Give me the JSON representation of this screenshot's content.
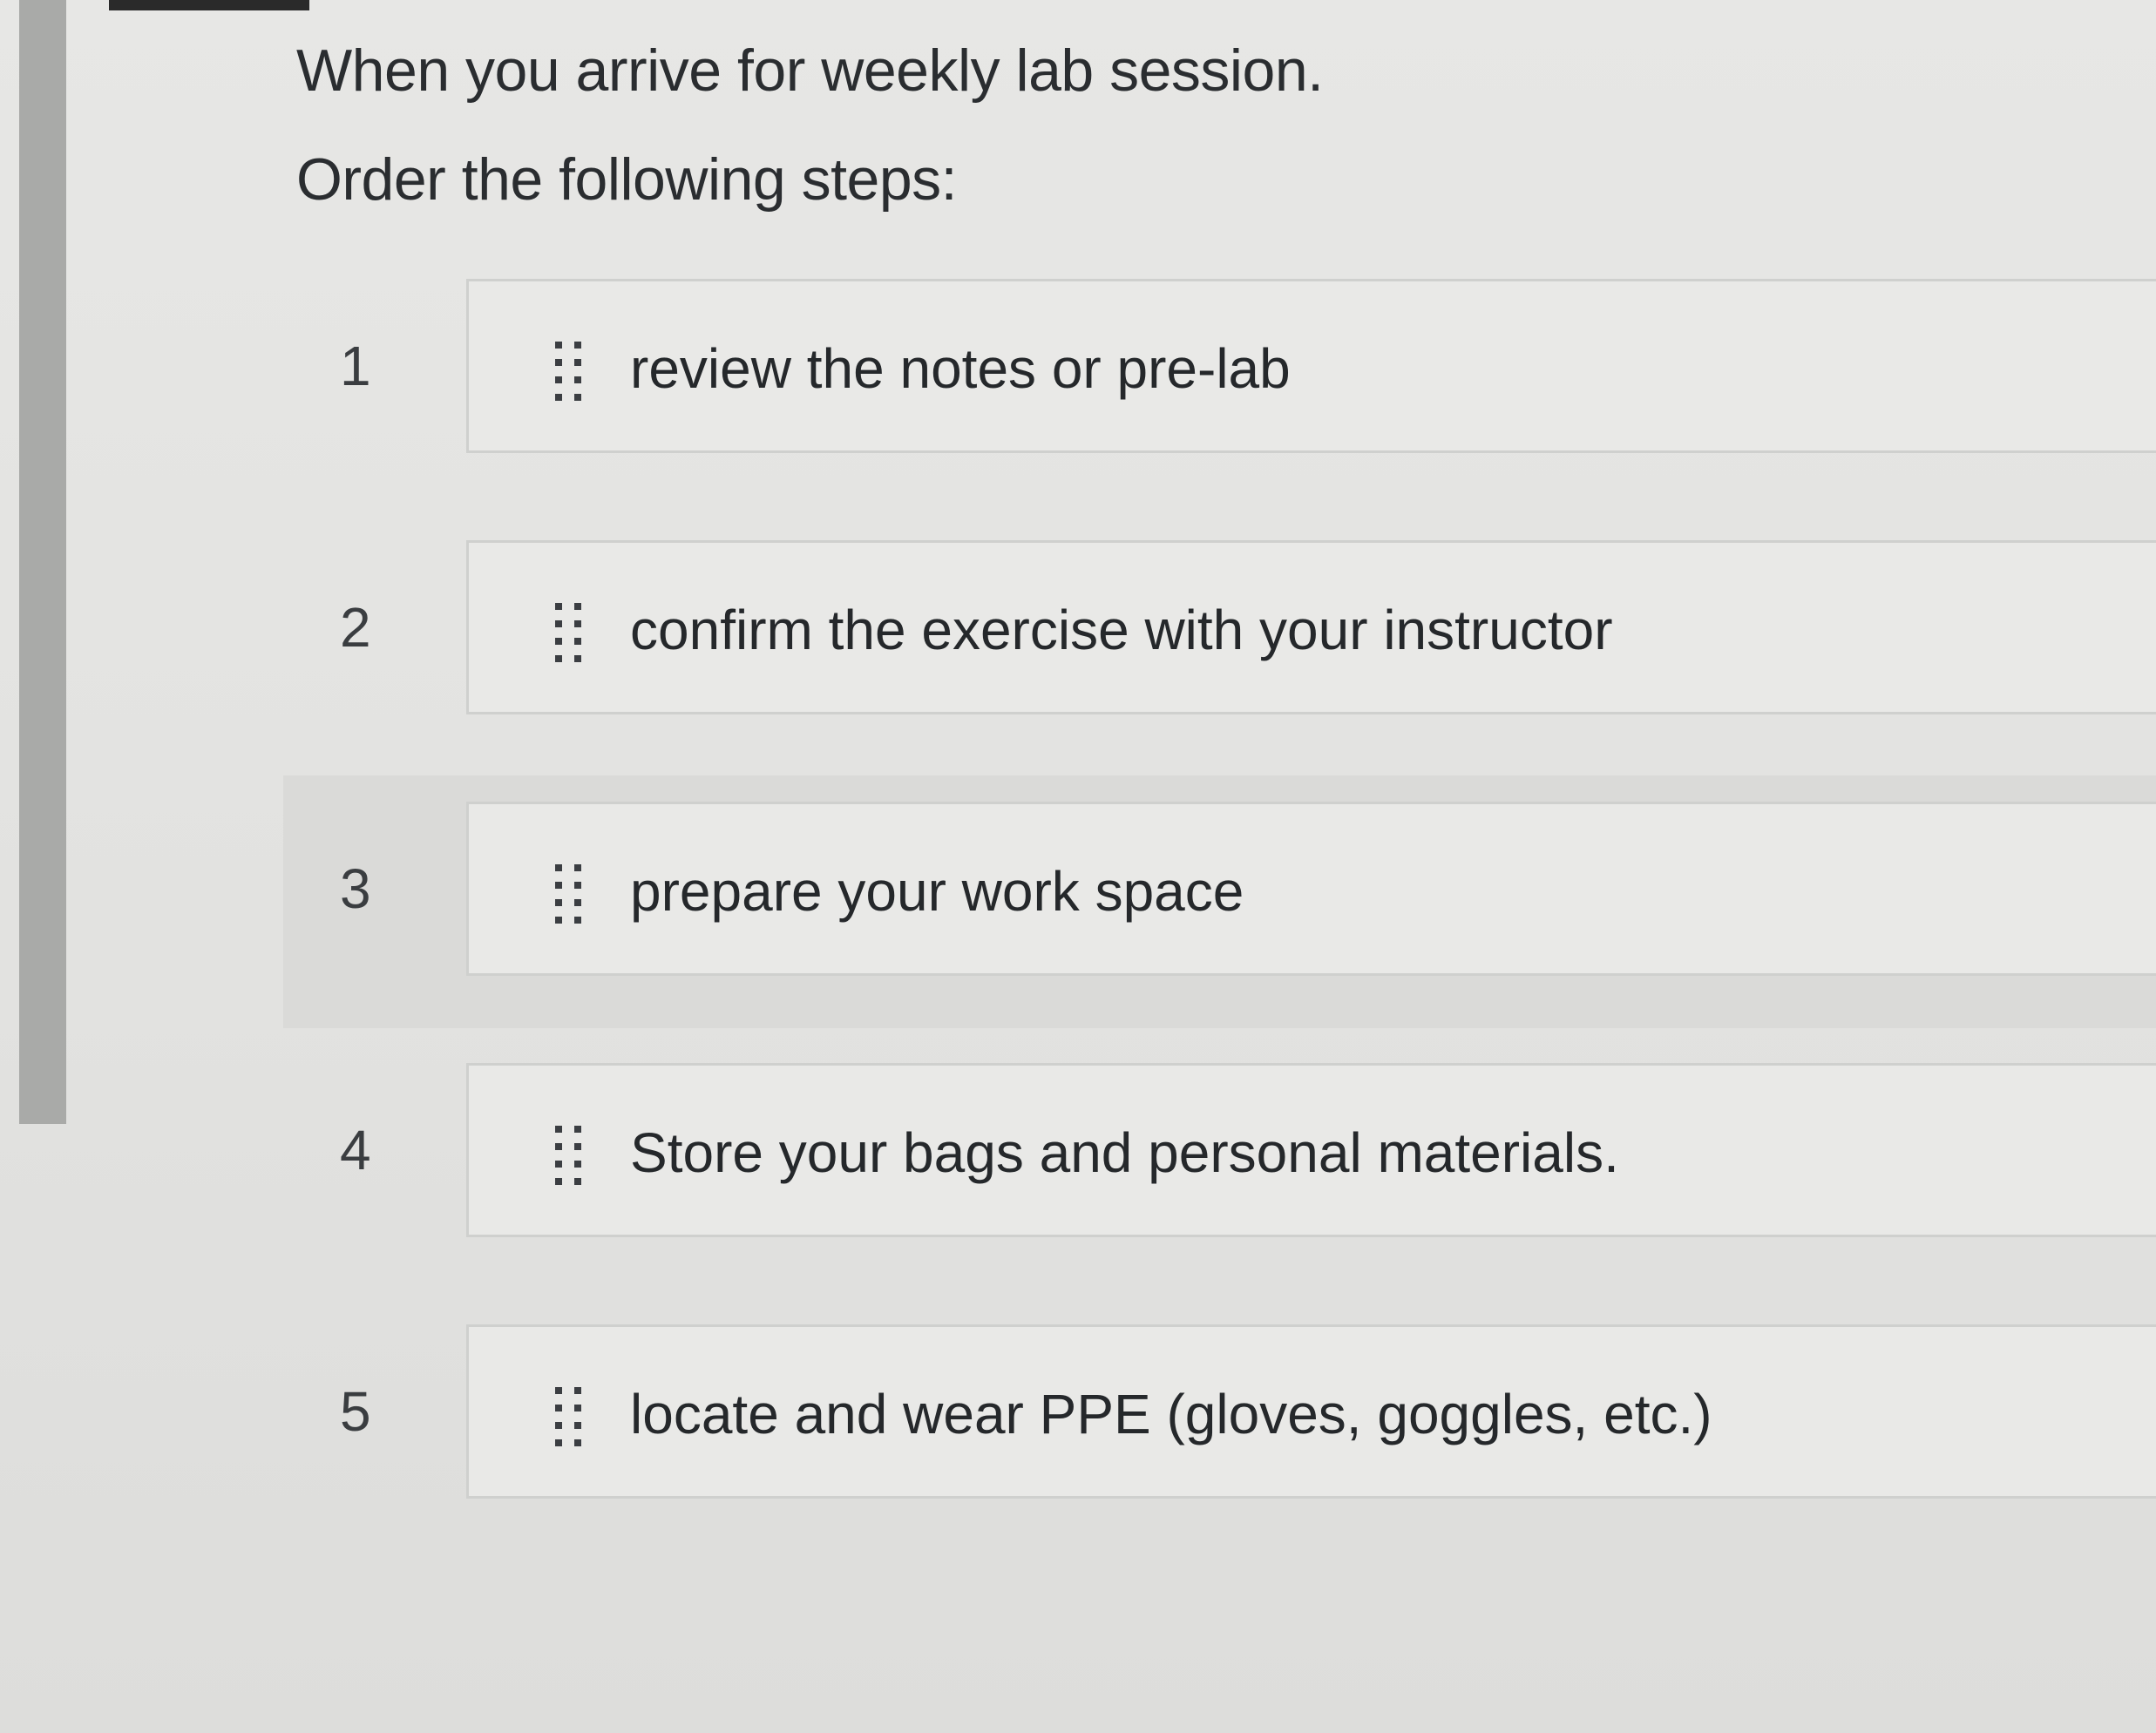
{
  "question": {
    "prompt_line_1": "When you arrive for weekly lab session.",
    "prompt_line_2": "Order the following steps:"
  },
  "ordering": {
    "items": [
      {
        "position": "1",
        "label": "review the notes or pre-lab",
        "icon": "drag-handle-icon"
      },
      {
        "position": "2",
        "label": "confirm the exercise with your instructor",
        "icon": "drag-handle-icon"
      },
      {
        "position": "3",
        "label": "prepare your work space",
        "icon": "drag-handle-icon"
      },
      {
        "position": "4",
        "label": "Store your bags and personal materials.",
        "icon": "drag-handle-icon"
      },
      {
        "position": "5",
        "label": "locate and wear PPE (gloves, goggles, etc.)",
        "icon": "drag-handle-icon"
      }
    ]
  },
  "colors": {
    "background": "#e4e4e2",
    "card": "#e9e9e7",
    "card_border": "#cfd0ce",
    "text": "#25282b",
    "left_rail": "#a9aaa8"
  }
}
